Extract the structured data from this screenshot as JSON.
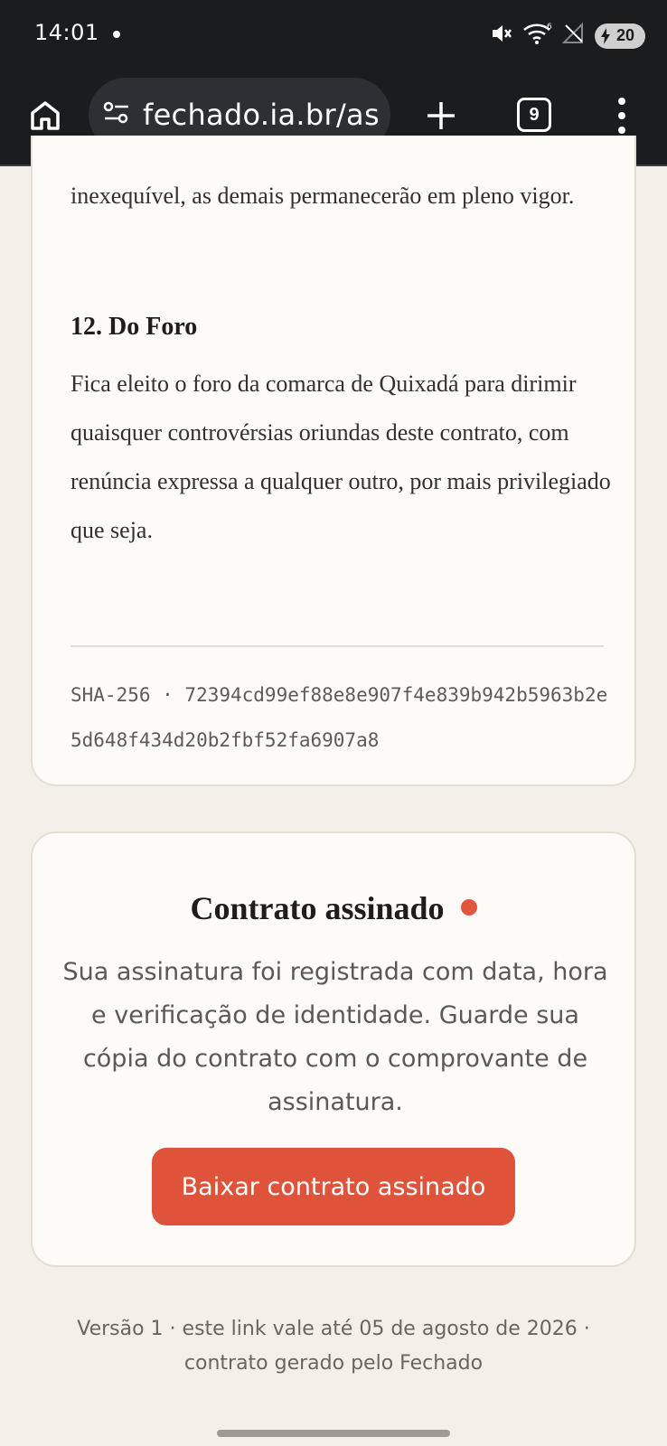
{
  "status_bar": {
    "time": "14:01",
    "battery": "20",
    "icons": [
      "mute-icon",
      "wifi-icon",
      "no-signal-icon",
      "charging-icon"
    ]
  },
  "browser": {
    "url": "fechado.ia.br/as",
    "tab_count": "9",
    "icons": [
      "home-icon",
      "site-settings-icon",
      "plus-icon",
      "tabs-icon",
      "menu-icon"
    ]
  },
  "contract": {
    "previous_paragraph_tail": "inexequível, as demais permanecerão em pleno vigor.",
    "clause_12_title": "12. Do Foro",
    "clause_12_body": "Fica eleito o foro da comarca de Quixadá para dirimir quaisquer controvérsias oriundas deste contrato, com renúncia expressa a qualquer outro, por mais privilegiado que seja.",
    "hash_line": "SHA-256 · 72394cd99ef88e8e907f4e839b942b5963b2e5d648f434d20b2fbf52fa6907a8"
  },
  "signed": {
    "title": "Contrato assinado",
    "message": "Sua assinatura foi registrada com data, hora e verificação de identidade. Guarde sua cópia do contrato com o comprovante de assinatura.",
    "download_label": "Baixar contrato assinado",
    "accent_color": "#e0553b"
  },
  "footer": {
    "text": "Versão 1 · este link vale até 05 de agosto de 2026 · contrato gerado pelo Fechado"
  }
}
